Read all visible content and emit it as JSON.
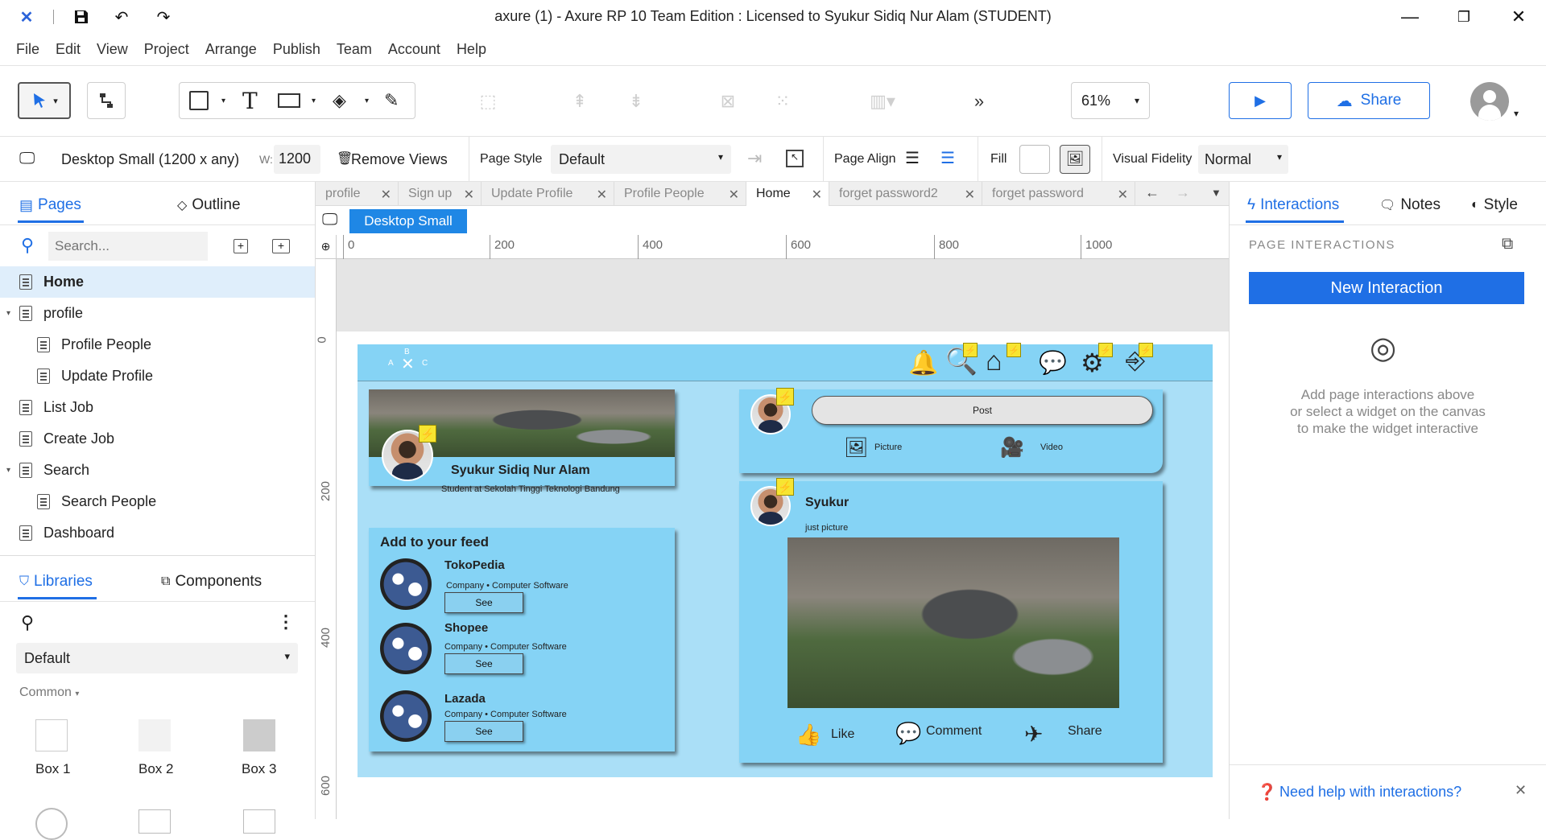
{
  "window": {
    "title": "axure (1) - Axure RP 10 Team Edition : Licensed to Syukur Sidiq Nur Alam (STUDENT)"
  },
  "menu": [
    "File",
    "Edit",
    "View",
    "Project",
    "Arrange",
    "Publish",
    "Team",
    "Account",
    "Help"
  ],
  "toolbar": {
    "zoom": "61%",
    "share_label": "Share"
  },
  "props": {
    "view_label": "Desktop Small (1200 x any)",
    "width_label": "W:",
    "width_value": "1200",
    "remove_views": "Remove Views",
    "page_style_label": "Page Style",
    "page_style_value": "Default",
    "page_align_label": "Page Align",
    "fill_label": "Fill",
    "visual_fidelity_label": "Visual Fidelity",
    "visual_fidelity_value": "Normal"
  },
  "left": {
    "tab_pages": "Pages",
    "tab_outline": "Outline",
    "search_placeholder": "Search...",
    "pages": [
      {
        "label": "Home"
      },
      {
        "label": "profile"
      },
      {
        "label": "Profile People"
      },
      {
        "label": "Update Profile"
      },
      {
        "label": "List Job"
      },
      {
        "label": "Create Job"
      },
      {
        "label": "Search"
      },
      {
        "label": "Search People"
      },
      {
        "label": "Dashboard"
      }
    ],
    "tab_libraries": "Libraries",
    "tab_components": "Components",
    "library_value": "Default",
    "common_label": "Common",
    "boxes": [
      "Box 1",
      "Box 2",
      "Box 3"
    ]
  },
  "tabs": [
    "profile",
    "Sign up",
    "Update Profile",
    "Profile People",
    "Home",
    "forget password2",
    "forget password"
  ],
  "view_badge": "Desktop Small",
  "ruler": {
    "top": [
      "0",
      "200",
      "400",
      "600",
      "800",
      "1000"
    ],
    "left": [
      "0",
      "200",
      "400",
      "600"
    ]
  },
  "design": {
    "logo_letters": [
      "A",
      "B",
      "C"
    ],
    "profile_name": "Syukur Sidiq Nur Alam",
    "profile_sub": "Student at Sekolah Tinggi Teknologi Bandung",
    "feed_title": "Add to your feed",
    "companies": [
      {
        "name": "TokoPedia",
        "type": "Company • Computer Software",
        "btn": "See"
      },
      {
        "name": "Shopee",
        "type": "Company • Computer Software",
        "btn": "See"
      },
      {
        "name": "Lazada",
        "type": "Company • Computer Software",
        "btn": "See"
      }
    ],
    "post_button": "Post",
    "picture_label": "Picture",
    "video_label": "Video",
    "post_author": "Syukur",
    "post_caption": "just picture",
    "like_label": "Like",
    "comment_label": "Comment",
    "share_label": "Share"
  },
  "right": {
    "tab_interactions": "Interactions",
    "tab_notes": "Notes",
    "tab_style": "Style",
    "section_title": "PAGE INTERACTIONS",
    "new_interaction": "New Interaction",
    "hint_1": "Add page interactions above",
    "hint_2": "or select a widget on the canvas",
    "hint_3": "to make the widget interactive",
    "help": "Need help with interactions?"
  },
  "colors": {
    "accent": "#1f6fe5",
    "design_bg": "#aadff7",
    "card": "#85d3f5",
    "bolt": "#f7e531"
  }
}
